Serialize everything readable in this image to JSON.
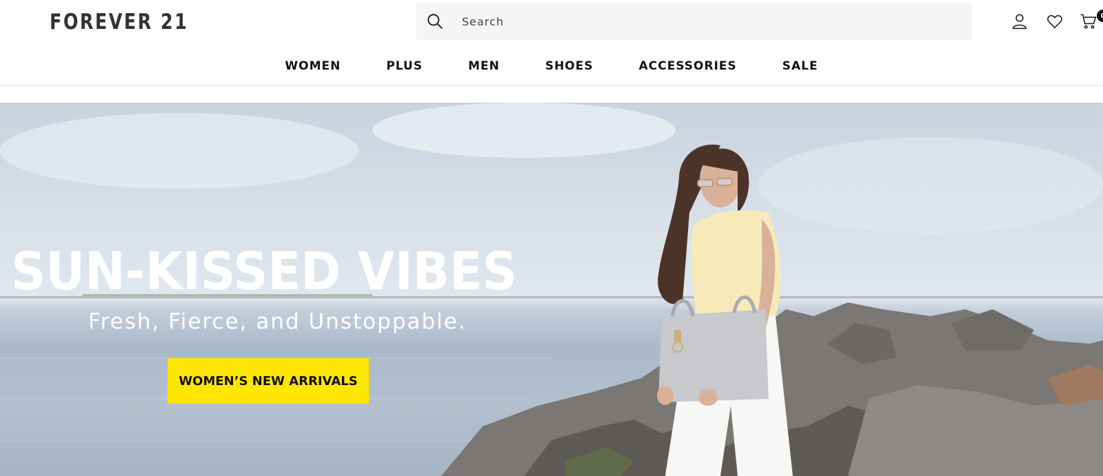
{
  "header": {
    "logo_text": "FOREVER 21",
    "search": {
      "placeholder": "Search",
      "value": ""
    },
    "cart_count": "0",
    "icons": [
      "search-icon",
      "user-icon",
      "heart-icon",
      "cart-icon"
    ]
  },
  "nav": {
    "items": [
      {
        "label": "WOMEN"
      },
      {
        "label": "PLUS"
      },
      {
        "label": "MEN"
      },
      {
        "label": "SHOES"
      },
      {
        "label": "ACCESSORIES"
      },
      {
        "label": "SALE"
      }
    ]
  },
  "hero": {
    "title": "SUN-KISSED VIBES",
    "subtitle": "Fresh, Fierce, and Unstoppable.",
    "cta_label": "WOMEN’S NEW ARRIVALS"
  },
  "colors": {
    "cta_background": "#ffe600",
    "hero_text": "#ffffff",
    "nav_text": "#111111",
    "search_background": "#f5f5f5"
  }
}
